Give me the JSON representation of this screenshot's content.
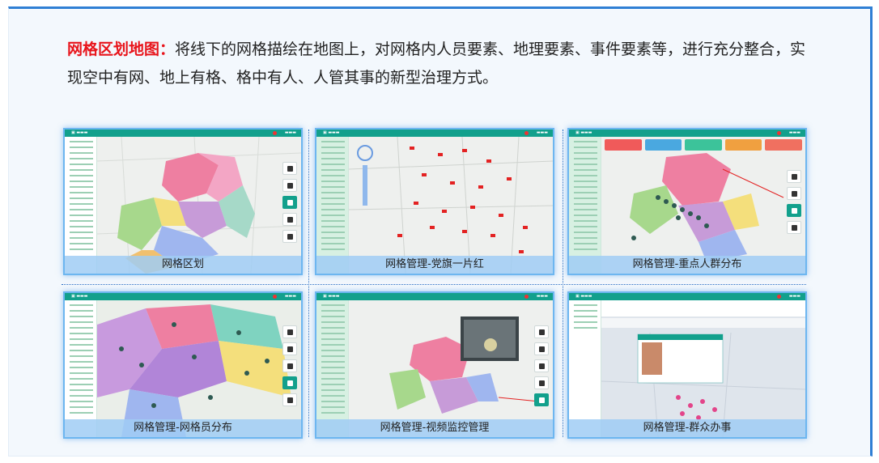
{
  "intro": {
    "lead": "网格区划地图：",
    "text": "将线下的网格描绘在地图上，对网格内人员要素、地理要素、事件要素等，进行充分整合，实现空中有网、地上有格、格中有人、人管其事的新型治理方式。"
  },
  "panels": [
    {
      "caption": "网格区划"
    },
    {
      "caption": "网格管理-党旗一片红"
    },
    {
      "caption": "网格管理-重点人群分布"
    },
    {
      "caption": "网格管理-网格员分布"
    },
    {
      "caption": "网格管理-视频监控管理"
    },
    {
      "caption": "网格管理-群众办事"
    }
  ],
  "colors": {
    "accent_red": "#e8141b",
    "teal": "#12a08c",
    "frame_blue": "#2f7fd4",
    "caption_bg": "#a0cdf5"
  }
}
